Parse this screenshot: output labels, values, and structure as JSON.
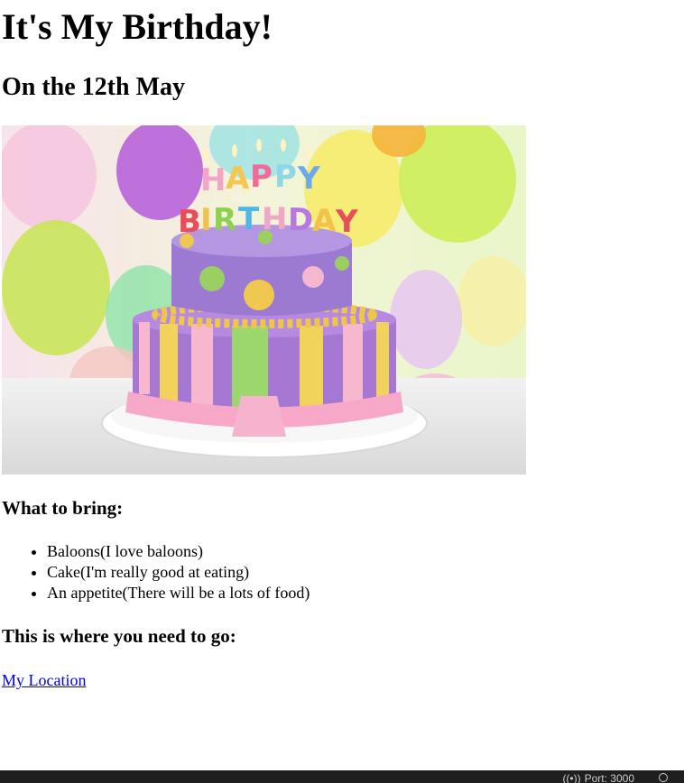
{
  "page": {
    "title": "It's My Birthday!",
    "subtitle": "On the 12th May",
    "bring_heading": "What to bring:",
    "bring_items": [
      "Baloons(I love baloons)",
      "Cake(I'm really good at eating)",
      "An appetite(There will be a lots of food)"
    ],
    "location_heading": "This is where you need to go:",
    "location_link": "My Location"
  },
  "status_bar": {
    "port_label": "Port: 3000"
  },
  "colors": {
    "link": "#0000ee",
    "status_bar_bg": "#1f1f1f"
  },
  "icons": [
    "broadcast-icon",
    "bell-icon"
  ]
}
